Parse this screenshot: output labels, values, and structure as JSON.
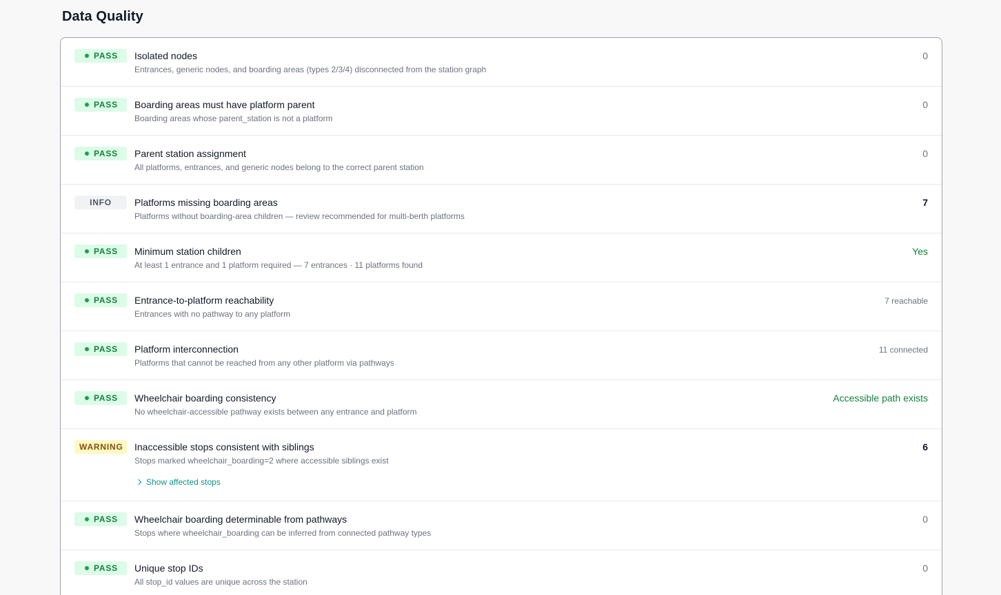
{
  "page": {
    "title": "Data Quality"
  },
  "checks": [
    {
      "status": "PASS",
      "name": "Isolated nodes",
      "description": "Entrances, generic nodes, and boarding areas (types 2/3/4) disconnected from the station graph",
      "value": "0"
    },
    {
      "status": "PASS",
      "name": "Boarding areas must have platform parent",
      "description": "Boarding areas whose parent_station is not a platform",
      "value": "0"
    },
    {
      "status": "PASS",
      "name": "Parent station assignment",
      "description": "All platforms, entrances, and generic nodes belong to the correct parent station",
      "value": "0"
    },
    {
      "status": "INFO",
      "name": "Platforms missing boarding areas",
      "description": "Platforms without boarding-area children — review recommended for multi-berth platforms",
      "value": "7"
    },
    {
      "status": "PASS",
      "name": "Minimum station children",
      "description": "At least 1 entrance and 1 platform required — 7 entrances · 11 platforms found",
      "value": "Yes"
    },
    {
      "status": "PASS",
      "name": "Entrance-to-platform reachability",
      "description": "Entrances with no pathway to any platform",
      "value": "7 reachable"
    },
    {
      "status": "PASS",
      "name": "Platform interconnection",
      "description": "Platforms that cannot be reached from any other platform via pathways",
      "value": "11 connected"
    },
    {
      "status": "PASS",
      "name": "Wheelchair boarding consistency",
      "description": "No wheelchair-accessible pathway exists between any entrance and platform",
      "value": "Accessible path exists"
    },
    {
      "status": "WARNING",
      "name": "Inaccessible stops consistent with siblings",
      "description": "Stops marked wheelchair_boarding=2 where accessible siblings exist",
      "value": "6",
      "expander": "Show affected stops"
    },
    {
      "status": "PASS",
      "name": "Wheelchair boarding determinable from pathways",
      "description": "Stops where wheelchair_boarding can be inferred from connected pathway types",
      "value": "0"
    },
    {
      "status": "PASS",
      "name": "Unique stop IDs",
      "description": "All stop_id values are unique across the station",
      "value": "0"
    }
  ],
  "colors": {
    "pass": "#15803d",
    "info": "#4b5563",
    "warning": "#854d0e",
    "link": "#0d9488"
  }
}
